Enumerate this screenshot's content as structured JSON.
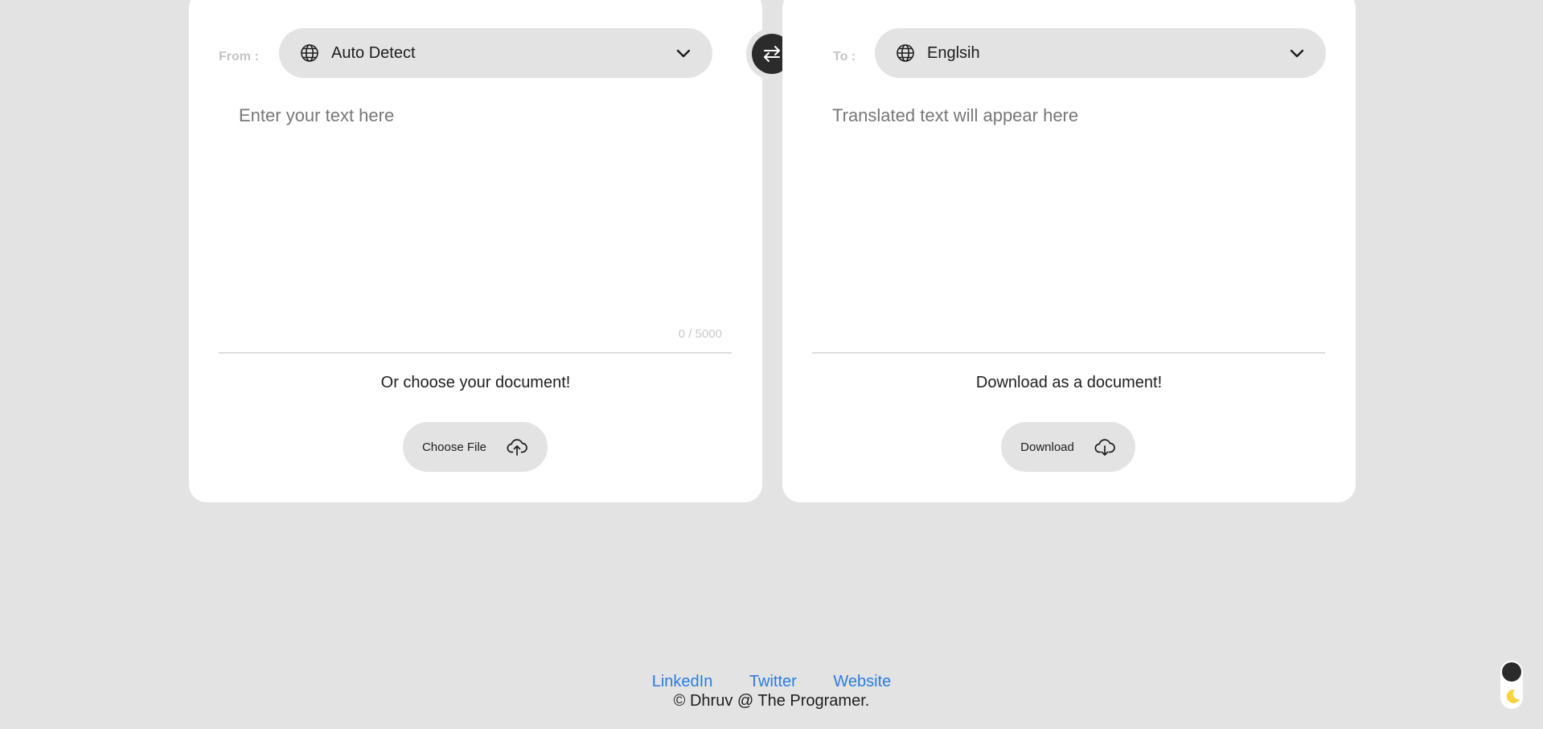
{
  "from_panel": {
    "direction_label": "From :",
    "language": "Auto Detect",
    "text_placeholder": "Enter your text here",
    "char_count": "0 / 5000",
    "doc_caption": "Or choose your document!",
    "file_button_label": "Choose File"
  },
  "to_panel": {
    "direction_label": "To :",
    "language": "Englsih",
    "text_placeholder": "Translated text will appear here",
    "doc_caption": "Download as a document!",
    "download_button_label": "Download"
  },
  "swap": {
    "icon": "swap-arrows-icon"
  },
  "footer": {
    "links": [
      "LinkedIn",
      "Twitter",
      "Website"
    ],
    "copyright": "© Dhruv @ The Programer."
  },
  "theme_toggle": {
    "icon": "moon-icon"
  },
  "colors": {
    "background": "#e3e3e3",
    "card": "#ffffff",
    "link": "#2a7ce0",
    "dark": "#2b2b2b",
    "moon": "#f6d33c"
  }
}
